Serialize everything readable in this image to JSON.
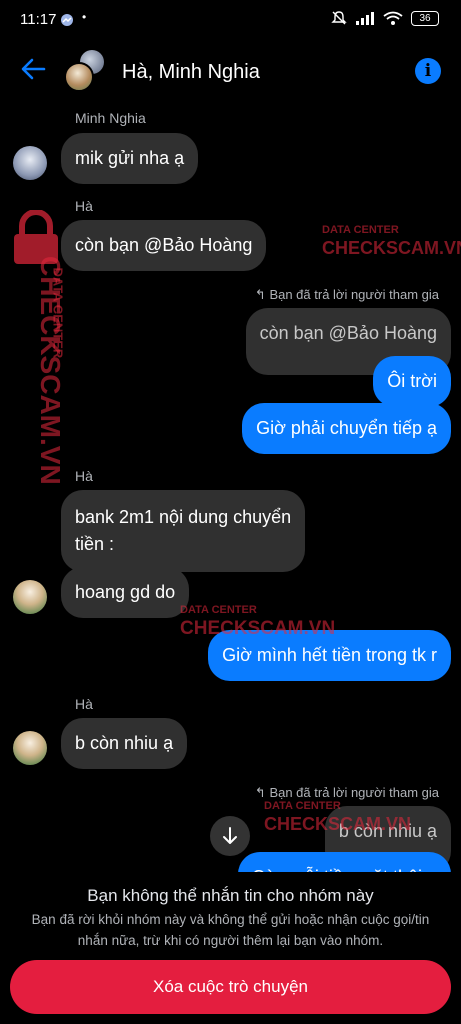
{
  "status": {
    "time": "11:17",
    "battery": "36"
  },
  "header": {
    "title": "Hà, Minh Nghia"
  },
  "messages": {
    "m1_sender": "Minh Nghia",
    "m1_text": "mik gửi nha ạ",
    "m2_sender": "Hà",
    "m2_text": "còn bạn @Bảo Hoàng",
    "reply1_label": "Bạn đã trả lời người tham gia",
    "reply1_quote": "còn bạn @Bảo Hoàng",
    "m3_text": "Ôi trời",
    "m4_text": "Giờ phải chuyển tiếp ạ",
    "m5_sender": "Hà",
    "m5_line1": "bank 2m1 nội dung chuyển",
    "m5_line2": "tiền :",
    "m6_text": "hoang gd do",
    "m7_text": "Giờ mình hết tiền trong tk r",
    "m8_sender": "Hà",
    "m8_text": "b còn nhiu ạ",
    "reply2_label": "Bạn đã trả lời người tham gia",
    "reply2_quote": "b còn nhiu ạ",
    "m9_text": "Còn mỗi tiền mặt thôi ạ"
  },
  "footer": {
    "title": "Bạn không thể nhắn tin cho nhóm này",
    "description": "Bạn đã rời khỏi nhóm này và không thể gửi hoặc nhận cuộc gọi/tin nhắn nữa, trừ khi có người thêm lại bạn vào nhóm.",
    "delete_label": "Xóa cuộc trò chuyện"
  },
  "watermark": {
    "line1": "DATA CENTER",
    "line2": "CHECKSCAM.VN"
  },
  "colors": {
    "accent": "#0a7cff",
    "incoming": "#303030",
    "danger": "#e41e3f"
  }
}
